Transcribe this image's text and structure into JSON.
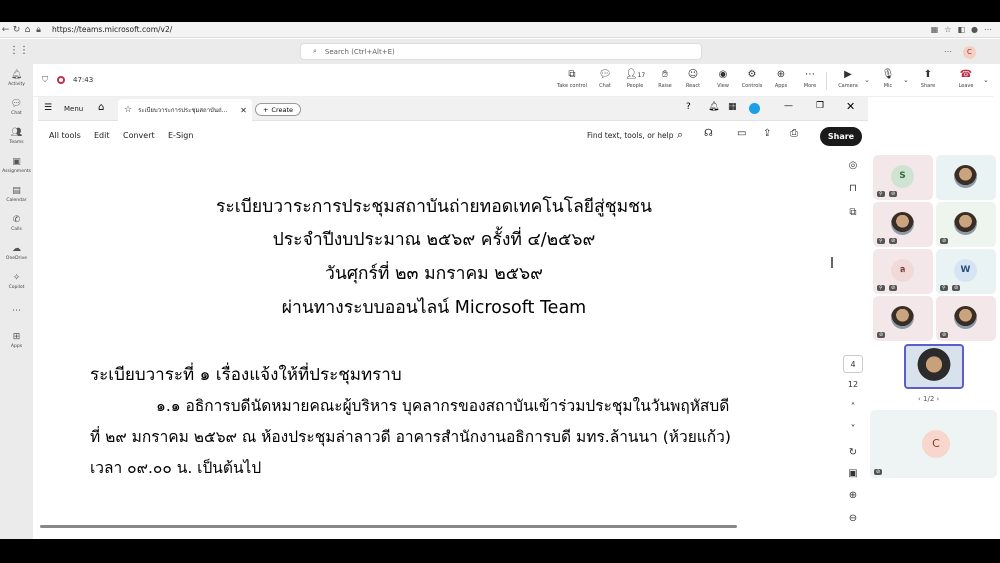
{
  "browser": {
    "url": "https://teams.microsoft.com/v2/"
  },
  "teams": {
    "search_placeholder": "Search (Ctrl+Alt+E)",
    "user_initial": "C",
    "rail": [
      "Activity",
      "Chat",
      "Teams",
      "Assignments",
      "Calendar",
      "Calls",
      "OneDrive",
      "Copilot",
      "Apps"
    ],
    "timer": "47:43",
    "meeting_buttons": [
      {
        "label": "Take control",
        "icon": "screen-icon"
      },
      {
        "label": "Chat",
        "icon": "chat-icon"
      },
      {
        "label": "People",
        "icon": "people-icon",
        "count": "17"
      },
      {
        "label": "Raise",
        "icon": "hand-icon"
      },
      {
        "label": "React",
        "icon": "smile-icon"
      },
      {
        "label": "View",
        "icon": "eye-icon"
      },
      {
        "label": "Controls",
        "icon": "controls-icon"
      },
      {
        "label": "Apps",
        "icon": "plus-icon"
      },
      {
        "label": "More",
        "icon": "more-icon"
      },
      {
        "label": "Camera",
        "icon": "camera-icon"
      },
      {
        "label": "Mic",
        "icon": "mic-icon"
      },
      {
        "label": "Share",
        "icon": "share-icon"
      },
      {
        "label": "Leave",
        "icon": "phone-icon"
      }
    ]
  },
  "acrobat": {
    "menu_label": "Menu",
    "tab_title": "ระเบียบวาระการประชุมสถาบันถ่...",
    "create_label": "Create",
    "tools": [
      "All tools",
      "Edit",
      "Convert",
      "E-Sign"
    ],
    "find_label": "Find text, tools, or help",
    "share_label": "Share",
    "page_current": "4",
    "page_total": "12"
  },
  "document": {
    "title_lines": [
      "ระเบียบวาระการประชุมสถาบันถ่ายทอดเทคโนโลยีสู่ชุมชน",
      "ประจำปีงบประมาณ ๒๕๖๙ ครั้งที่ ๔/๒๕๖๙",
      "วันศุกร์ที่ ๒๓ มกราคม ๒๕๖๙",
      "ผ่านทางระบบออนไลน์ Microsoft Team"
    ],
    "agenda_heading": "ระเบียบวาระที่ ๑ เรื่องแจ้งให้ที่ประชุมทราบ",
    "body_lines": [
      "๑.๑ อธิการบดีนัดหมายคณะผู้บริหาร บุคลากรของสถาบันเข้าร่วมประชุมในวันพฤหัสบดี",
      "ที่ ๒๙ มกราคม ๒๕๖๙ ณ ห้องประชุมล่าลาวดี อาคารสำนักงานอธิการบดี มทร.ล้านนา (ห้วยแก้ว)",
      "เวลา ๐๙.๐๐ น. เป็นต้นไป"
    ]
  },
  "video": {
    "tiles": [
      "S",
      "",
      "",
      "",
      "ล",
      "W",
      "",
      ""
    ],
    "pager": "1/2",
    "big_tile_initial": "C"
  }
}
